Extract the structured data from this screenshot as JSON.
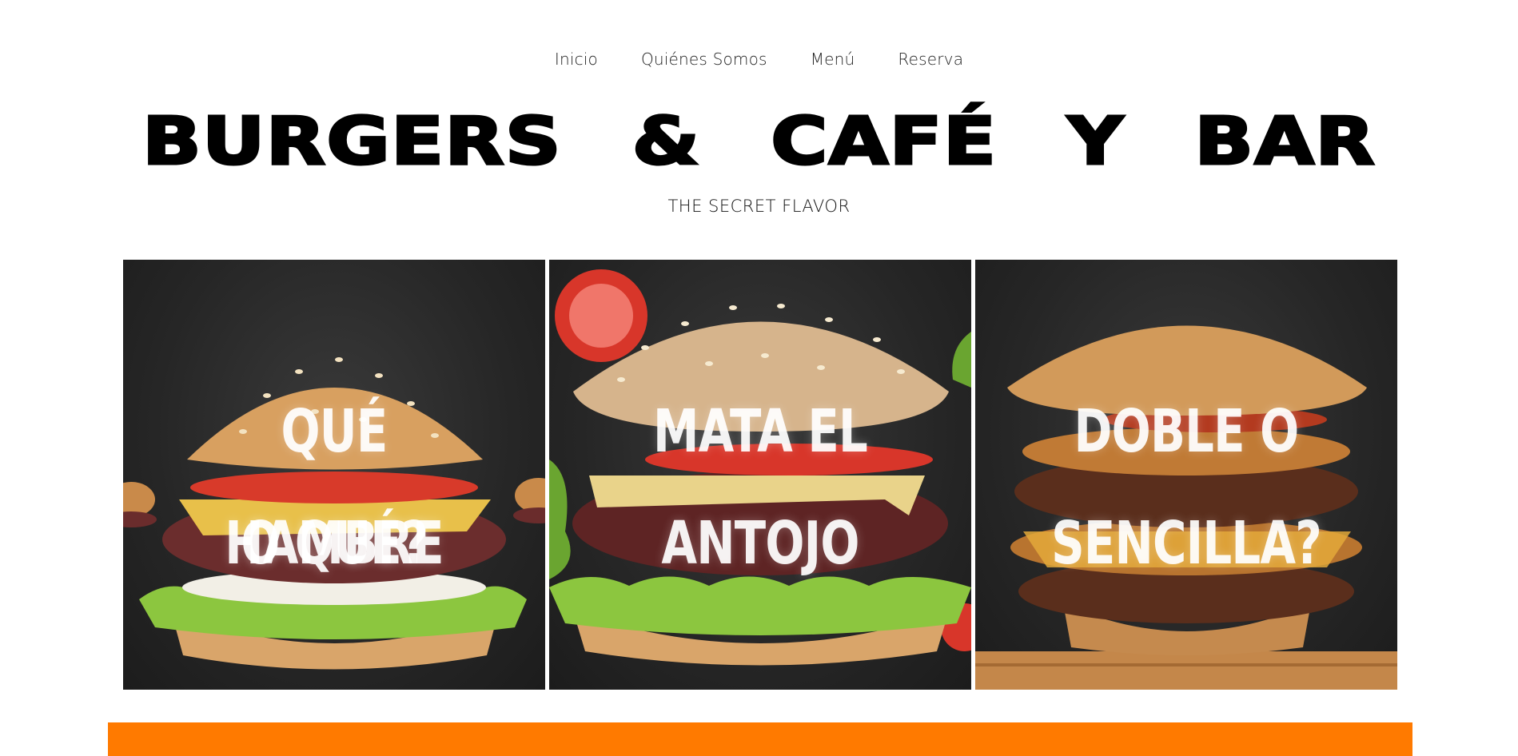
{
  "nav": {
    "items": [
      {
        "label": "Inicio"
      },
      {
        "label": "Quiénes Somos"
      },
      {
        "label": "Menú"
      },
      {
        "label": "Reserva"
      }
    ]
  },
  "header": {
    "title": "BURGERS & CAFÉ Y BAR",
    "tagline": "THE SECRET FLAVOR"
  },
  "gallery": {
    "cards": [
      {
        "line1": "QUÉ HAMBRE",
        "line2": "O QUÉ?"
      },
      {
        "line1": "MATA EL",
        "line2": "ANTOJO"
      },
      {
        "line1": "DOBLE O",
        "line2": "SENCILLA?"
      }
    ]
  },
  "colors": {
    "accent": "#ff7a00",
    "card_background": "#262626",
    "text": "#000000"
  }
}
